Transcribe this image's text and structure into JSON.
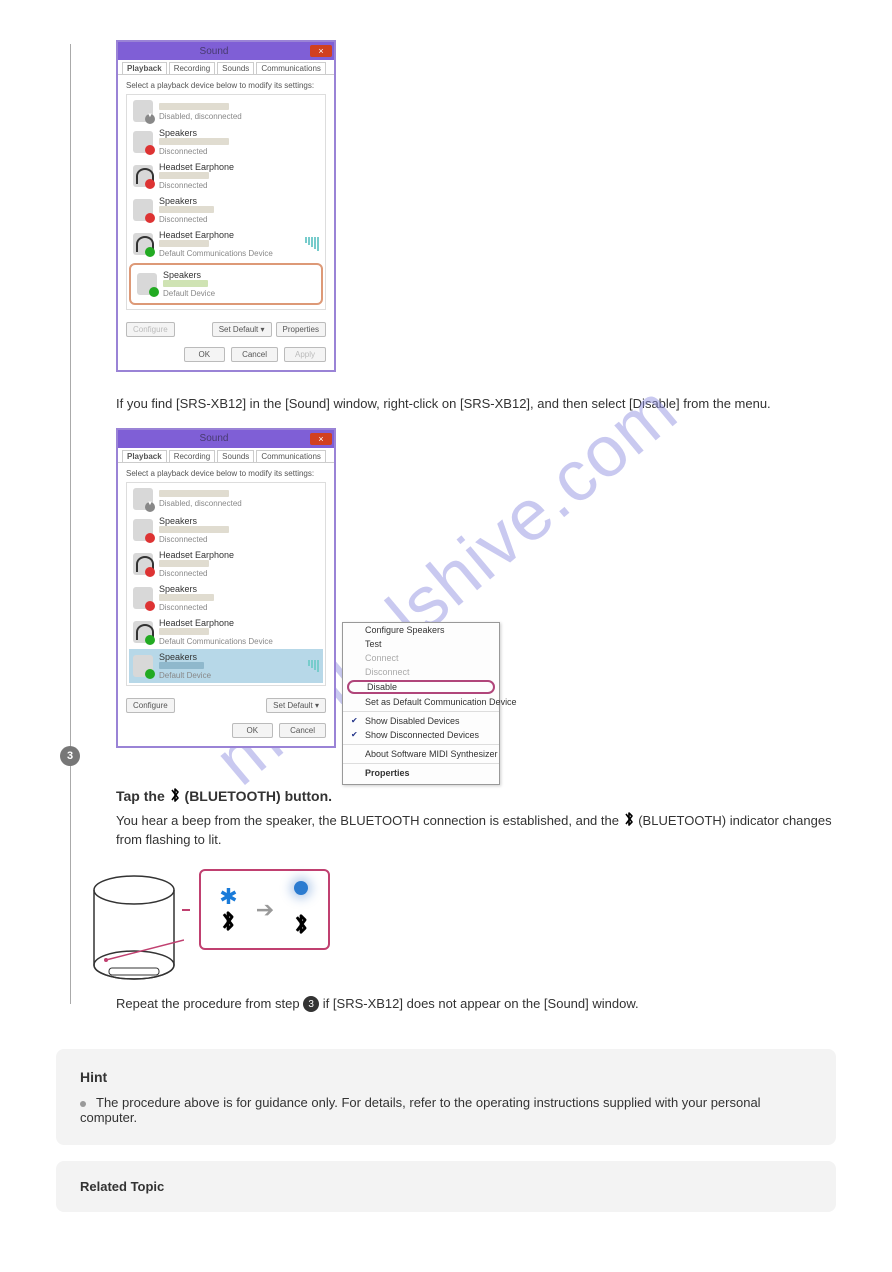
{
  "watermark": "manualshive.com",
  "dialog1": {
    "title": "Sound",
    "close_label": "×",
    "tabs": [
      "Playback",
      "Recording",
      "Sounds",
      "Communications"
    ],
    "instruction": "Select a playback device below to modify its settings:",
    "devices": [
      {
        "name": "",
        "status": "Disabled, disconnected"
      },
      {
        "name": "Speakers",
        "status": "Disconnected"
      },
      {
        "name": "Headset Earphone",
        "status": "Disconnected"
      },
      {
        "name": "Speakers",
        "status": "Disconnected"
      },
      {
        "name": "Headset Earphone",
        "status": "Default Communications Device"
      },
      {
        "name": "Speakers",
        "status": "Default Device"
      }
    ],
    "btn_configure": "Configure",
    "btn_setdefault": "Set Default",
    "btn_properties": "Properties",
    "btn_ok": "OK",
    "btn_cancel": "Cancel",
    "btn_apply": "Apply"
  },
  "intertext": "If you find [SRS-XB12] in the [Sound] window, right-click on [SRS-XB12], and then select [Disable] from the menu.",
  "dialog2": {
    "title": "Sound",
    "close_label": "×",
    "tabs": [
      "Playback",
      "Recording",
      "Sounds",
      "Communications"
    ],
    "instruction": "Select a playback device below to modify its settings:",
    "devices": [
      {
        "name": "",
        "status": "Disabled, disconnected"
      },
      {
        "name": "Speakers",
        "status": "Disconnected"
      },
      {
        "name": "Headset Earphone",
        "status": "Disconnected"
      },
      {
        "name": "Speakers",
        "status": "Disconnected"
      },
      {
        "name": "Headset Earphone",
        "status": "Default Communications Device"
      },
      {
        "name": "Speakers",
        "status": "Default Device"
      }
    ],
    "btn_configure": "Configure",
    "btn_setdefault": "Set Default",
    "btn_ok": "OK",
    "btn_cancel": "Cancel"
  },
  "contextmenu": {
    "items": [
      {
        "label": "Configure Speakers",
        "disabled": false
      },
      {
        "label": "Test",
        "disabled": false
      },
      {
        "label": "Connect",
        "disabled": true
      },
      {
        "label": "Disconnect",
        "disabled": true
      },
      {
        "label": "Disable",
        "disabled": false,
        "highlight": true
      },
      {
        "label": "Set as Default Communication Device",
        "disabled": false
      },
      {
        "label": "Show Disabled Devices",
        "disabled": false,
        "checked": true
      },
      {
        "label": "Show Disconnected Devices",
        "disabled": false,
        "checked": true
      },
      {
        "label": "About Software MIDI Synthesizer",
        "disabled": false
      },
      {
        "label": "Properties",
        "disabled": false,
        "bold": true
      }
    ]
  },
  "step3": {
    "num": "3",
    "text_a": "Tap the ",
    "bt_word": " (BLUETOOTH) button.",
    "text_b": "You hear a beep from the speaker, the BLUETOOTH connection is established, and the ",
    "text_c": " (BLUETOOTH) indicator changes from flashing to lit.",
    "text_d_a": "Repeat the procedure from step ",
    "text_d_num": "3",
    "text_d_b": " if [SRS-XB12] does not appear on the [Sound] window."
  },
  "bt_glyph": "✱",
  "hint": {
    "title": "Hint",
    "bullet": "The procedure above is for guidance only. For details, refer to the operating instructions supplied with your personal computer."
  },
  "related": {
    "title": "Related Topic"
  }
}
